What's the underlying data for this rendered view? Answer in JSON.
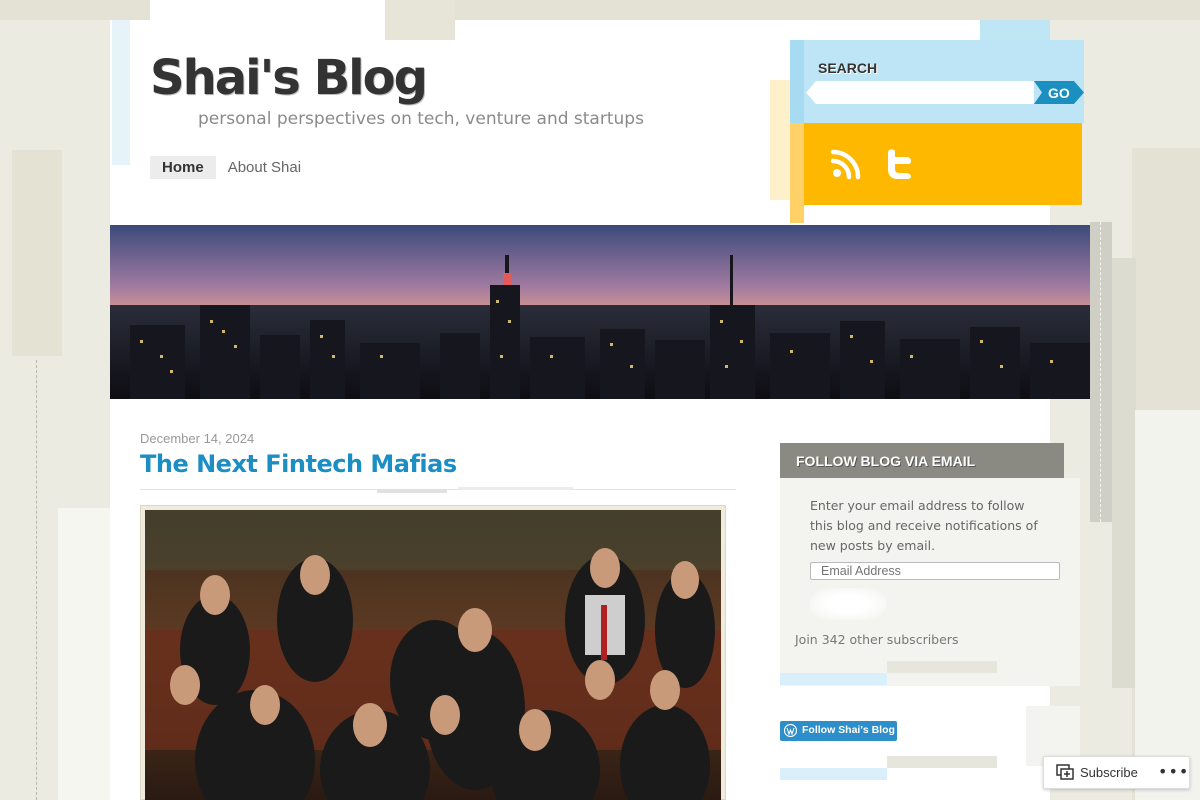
{
  "site": {
    "title": "Shai's Blog",
    "tagline": "personal perspectives on tech, venture and startups"
  },
  "nav": {
    "items": [
      {
        "label": "Home",
        "active": true
      },
      {
        "label": "About Shai",
        "active": false
      }
    ]
  },
  "search": {
    "label": "SEARCH",
    "placeholder": "",
    "button_label": "GO"
  },
  "social": {
    "icons": [
      "rss-icon",
      "twitter-icon"
    ],
    "color": "#ffb800"
  },
  "banner": {
    "description_icon": "city-skyline-image"
  },
  "post": {
    "date": "December 14, 2024",
    "title": "The Next Fintech Mafias",
    "image_icon": "group-photo-image"
  },
  "follow": {
    "heading": "FOLLOW BLOG VIA EMAIL",
    "description": "Enter your email address to follow this blog and receive notifications of new posts by email.",
    "email_placeholder": "Email Address",
    "subscribers": "Join 342 other subscribers",
    "badge_label": "Follow Shai's Blog"
  },
  "subscribe_bar": {
    "subscribe_label": "Subscribe",
    "more_label": "•••"
  },
  "colors": {
    "accent": "#1c8ec4",
    "search_bg": "#bde5f6",
    "social_bg": "#ffb800",
    "widget_head": "#8a8a82"
  }
}
